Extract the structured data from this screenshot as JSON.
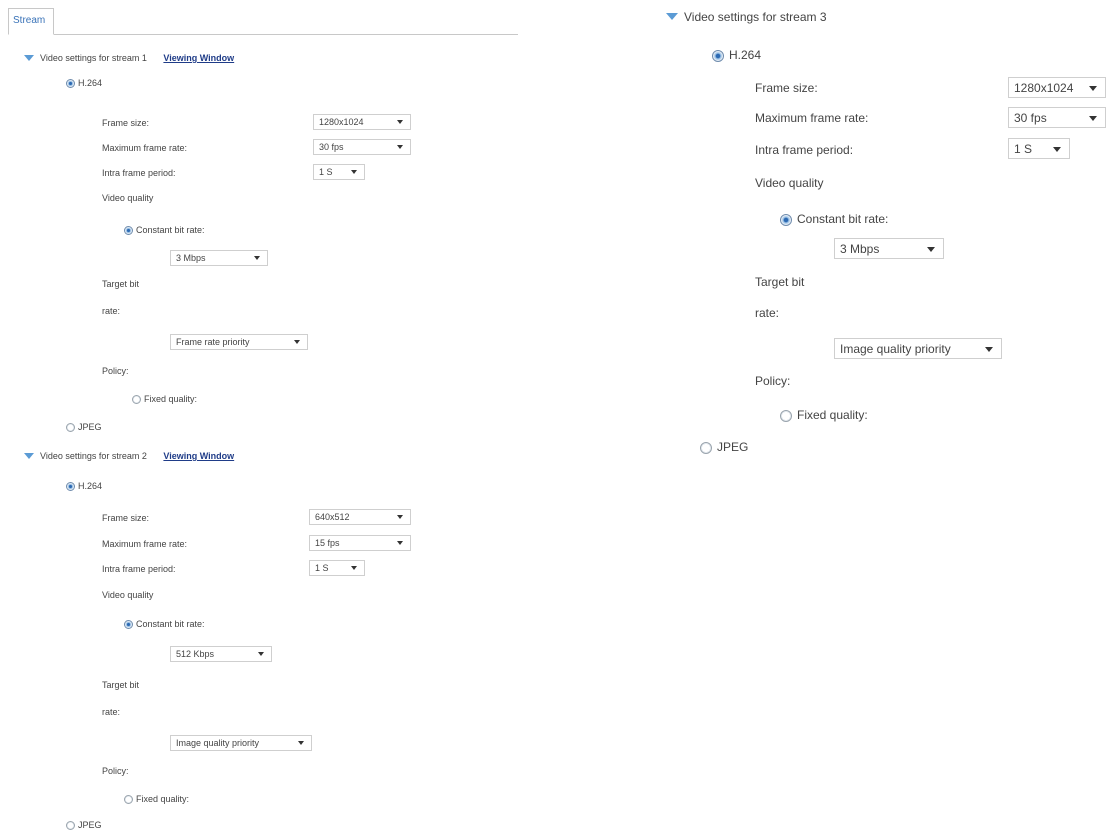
{
  "tab": {
    "label": "Stream"
  },
  "viewing_window_label": "Viewing Window",
  "labels": {
    "frame_size": "Frame size:",
    "max_frame_rate": "Maximum frame rate:",
    "intra_frame_period": "Intra frame period:",
    "video_quality": "Video quality",
    "constant_bit_rate": "Constant bit rate:",
    "target_bit": "Target bit",
    "rate": "rate:",
    "policy": "Policy:",
    "fixed_quality": "Fixed quality:",
    "h264": "H.264",
    "jpeg": "JPEG"
  },
  "streams": [
    {
      "title": "Video settings for stream 1",
      "codec_selected": "H.264",
      "frame_size": "1280x1024",
      "max_frame_rate": "30 fps",
      "intra_frame_period": "1 S",
      "quality_mode_selected": "Constant bit rate",
      "target_bit_rate": "3 Mbps",
      "policy": "Frame rate priority"
    },
    {
      "title": "Video settings for stream 2",
      "codec_selected": "H.264",
      "frame_size": "640x512",
      "max_frame_rate": "15 fps",
      "intra_frame_period": "1 S",
      "quality_mode_selected": "Constant bit rate",
      "target_bit_rate": "512 Kbps",
      "policy": "Image quality priority"
    },
    {
      "title": "Video settings for stream 3",
      "codec_selected": "H.264",
      "frame_size": "1280x1024",
      "max_frame_rate": "30 fps",
      "intra_frame_period": "1 S",
      "quality_mode_selected": "Constant bit rate",
      "target_bit_rate": "3 Mbps",
      "policy": "Image quality priority"
    }
  ],
  "colors": {
    "tab_text": "#3a73b8",
    "link": "#1f3c88",
    "caret": "#5b9bd5",
    "radio_selected": "#2d6ab3"
  }
}
